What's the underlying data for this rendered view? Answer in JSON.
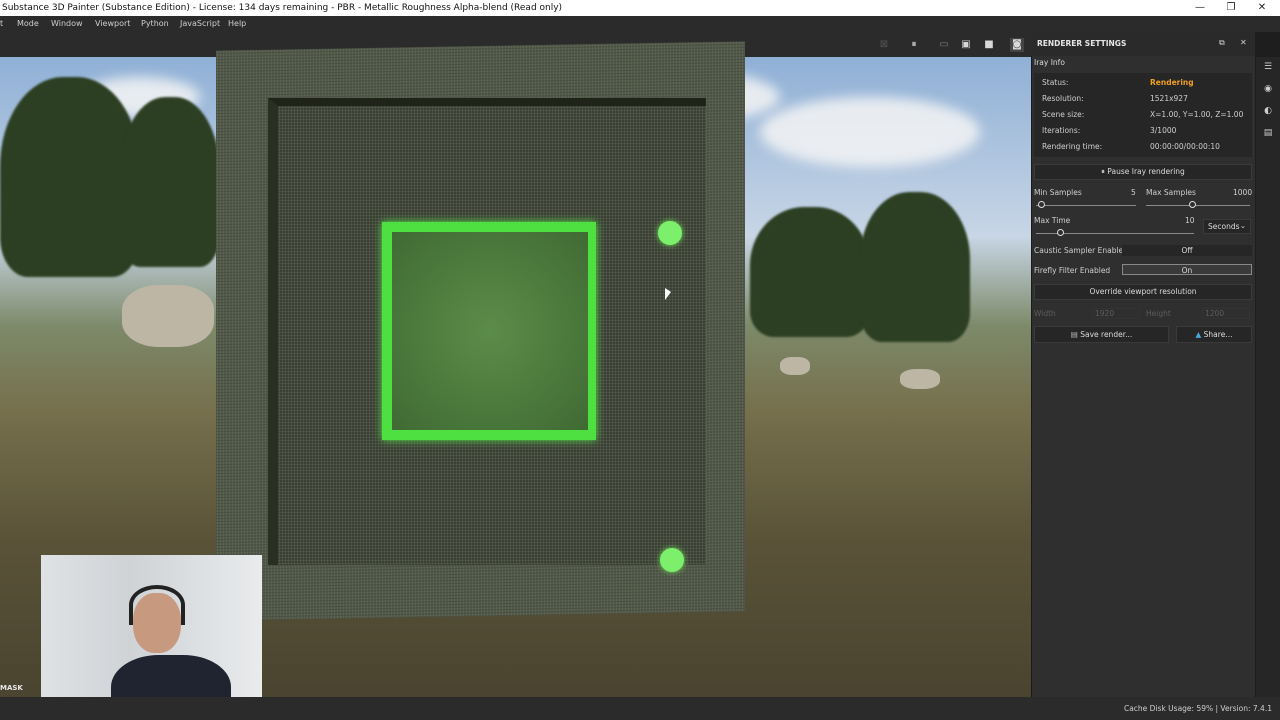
{
  "titlebar": {
    "title": "Substance 3D Painter (Substance Edition) - License: 134 days remaining - PBR - Metallic Roughness Alpha-blend (Read only)",
    "minimize_glyph": "—",
    "maximize_glyph": "❐",
    "close_glyph": "✕"
  },
  "menu": {
    "items": [
      "t",
      "Mode",
      "Window",
      "Viewport",
      "Python",
      "JavaScript",
      "Help"
    ]
  },
  "toolbar": {
    "icons": [
      "image-icon",
      "pause-icon",
      "frame-icon",
      "cube-icon",
      "camera-icon",
      "screenshot-icon"
    ],
    "glyphs": [
      "⊠",
      "⏸",
      "▭",
      "▣",
      "■",
      "◙"
    ]
  },
  "viewport": {
    "mask_label": "MASK"
  },
  "renderer": {
    "title": "RENDERER SETTINGS",
    "float_glyph": "⧉",
    "close_glyph": "✕",
    "section": "Iray Info",
    "status_label": "Status:",
    "status_value": "Rendering",
    "resolution_label": "Resolution:",
    "resolution_value": "1521x927",
    "scene_label": "Scene size:",
    "scene_value": "X=1.00, Y=1.00, Z=1.00",
    "iterations_label": "Iterations:",
    "iterations_value": "3/1000",
    "time_label": "Rendering time:",
    "time_value": "00:00:00/00:00:10",
    "pause_button": "⏸ Pause Iray rendering",
    "min_samples_label": "Min Samples",
    "min_samples_value": "5",
    "max_samples_label": "Max Samples",
    "max_samples_value": "1000",
    "max_time_label": "Max Time",
    "max_time_value": "10",
    "time_unit": "Seconds",
    "time_unit_chevron": "⌄",
    "caustic_label": "Caustic Sampler Enabled",
    "caustic_value": "Off",
    "firefly_label": "Firefly Filter Enabled",
    "firefly_value": "On",
    "override_button": "Override viewport resolution",
    "width_label": "Width",
    "width_value": "1920",
    "height_label": "Height",
    "height_value": "1200",
    "save_button": "Save render...",
    "share_button": "Share..."
  },
  "sidebar": {
    "icons": [
      "layers-icon",
      "settings-icon",
      "material-icon",
      "document-icon"
    ],
    "glyphs": [
      "☰",
      "◉",
      "◐",
      "▤"
    ]
  },
  "status": {
    "text": "Cache Disk Usage:   59% | Version: 7.4.1"
  },
  "colors": {
    "accent": "#f0a020",
    "panel": "#2f2f2f",
    "glow": "#4ee040"
  }
}
